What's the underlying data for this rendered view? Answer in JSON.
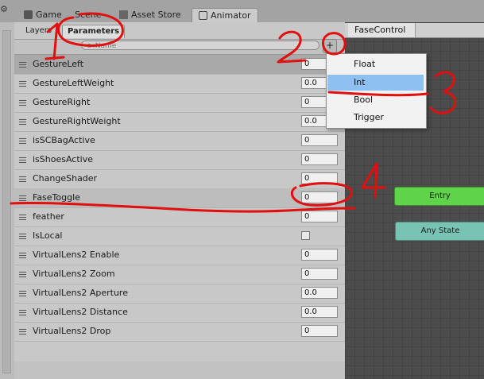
{
  "tabs": [
    {
      "label": "Game",
      "icon": "game-controller-icon"
    },
    {
      "label": "Scene",
      "icon": "scene-icon"
    },
    {
      "label": "Asset Store",
      "icon": "asset-store-icon"
    },
    {
      "label": "Animator",
      "icon": "animator-icon"
    }
  ],
  "params_panel": {
    "subtabs": [
      "Layers",
      "Parameters"
    ],
    "search_placeholder": "Name",
    "add_button": "+",
    "rows": [
      {
        "name": "GestureLeft",
        "value": "0",
        "type": "int"
      },
      {
        "name": "GestureLeftWeight",
        "value": "0.0",
        "type": "float"
      },
      {
        "name": "GestureRight",
        "value": "0",
        "type": "int"
      },
      {
        "name": "GestureRightWeight",
        "value": "0.0",
        "type": "float"
      },
      {
        "name": "isSCBagActive",
        "value": "0",
        "type": "int"
      },
      {
        "name": "isShoesActive",
        "value": "0",
        "type": "int"
      },
      {
        "name": "ChangeShader",
        "value": "0",
        "type": "int"
      },
      {
        "name": "FaseToggle",
        "value": "0",
        "type": "int"
      },
      {
        "name": "feather",
        "value": "0",
        "type": "int"
      },
      {
        "name": "IsLocal",
        "value": "",
        "type": "bool"
      },
      {
        "name": "VirtualLens2 Enable",
        "value": "0",
        "type": "int"
      },
      {
        "name": "VirtualLens2 Zoom",
        "value": "0",
        "type": "int"
      },
      {
        "name": "VirtualLens2 Aperture",
        "value": "0.0",
        "type": "float"
      },
      {
        "name": "VirtualLens2 Distance",
        "value": "0.0",
        "type": "float"
      },
      {
        "name": "VirtualLens2 Drop",
        "value": "0",
        "type": "int"
      }
    ]
  },
  "dropdown": {
    "items": [
      "Float",
      "Int",
      "Bool",
      "Trigger"
    ],
    "selected": "Int"
  },
  "graph": {
    "breadcrumb": "FaseControl",
    "nodes": [
      {
        "label": "Entry",
        "color": "#5fd44a"
      },
      {
        "label": "Any State",
        "color": "#79c3b4"
      }
    ]
  },
  "annotations": {
    "color": "#e01010",
    "labels": [
      "1",
      "2",
      "3",
      "4"
    ]
  }
}
